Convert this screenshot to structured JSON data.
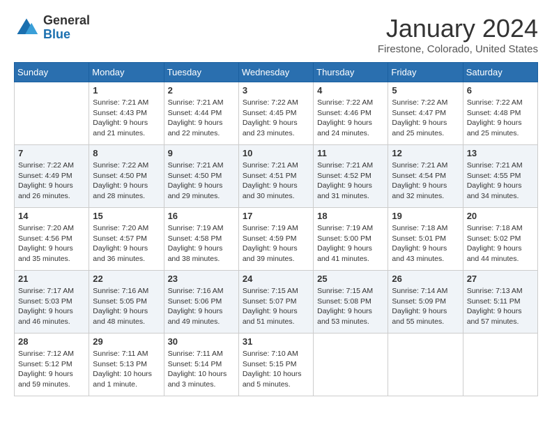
{
  "header": {
    "logo": {
      "general": "General",
      "blue": "Blue"
    },
    "title": "January 2024",
    "location": "Firestone, Colorado, United States"
  },
  "calendar": {
    "days_of_week": [
      "Sunday",
      "Monday",
      "Tuesday",
      "Wednesday",
      "Thursday",
      "Friday",
      "Saturday"
    ],
    "weeks": [
      [
        {
          "day": "",
          "info": ""
        },
        {
          "day": "1",
          "info": "Sunrise: 7:21 AM\nSunset: 4:43 PM\nDaylight: 9 hours\nand 21 minutes."
        },
        {
          "day": "2",
          "info": "Sunrise: 7:21 AM\nSunset: 4:44 PM\nDaylight: 9 hours\nand 22 minutes."
        },
        {
          "day": "3",
          "info": "Sunrise: 7:22 AM\nSunset: 4:45 PM\nDaylight: 9 hours\nand 23 minutes."
        },
        {
          "day": "4",
          "info": "Sunrise: 7:22 AM\nSunset: 4:46 PM\nDaylight: 9 hours\nand 24 minutes."
        },
        {
          "day": "5",
          "info": "Sunrise: 7:22 AM\nSunset: 4:47 PM\nDaylight: 9 hours\nand 25 minutes."
        },
        {
          "day": "6",
          "info": "Sunrise: 7:22 AM\nSunset: 4:48 PM\nDaylight: 9 hours\nand 25 minutes."
        }
      ],
      [
        {
          "day": "7",
          "info": "Sunrise: 7:22 AM\nSunset: 4:49 PM\nDaylight: 9 hours\nand 26 minutes."
        },
        {
          "day": "8",
          "info": "Sunrise: 7:22 AM\nSunset: 4:50 PM\nDaylight: 9 hours\nand 28 minutes."
        },
        {
          "day": "9",
          "info": "Sunrise: 7:21 AM\nSunset: 4:50 PM\nDaylight: 9 hours\nand 29 minutes."
        },
        {
          "day": "10",
          "info": "Sunrise: 7:21 AM\nSunset: 4:51 PM\nDaylight: 9 hours\nand 30 minutes."
        },
        {
          "day": "11",
          "info": "Sunrise: 7:21 AM\nSunset: 4:52 PM\nDaylight: 9 hours\nand 31 minutes."
        },
        {
          "day": "12",
          "info": "Sunrise: 7:21 AM\nSunset: 4:54 PM\nDaylight: 9 hours\nand 32 minutes."
        },
        {
          "day": "13",
          "info": "Sunrise: 7:21 AM\nSunset: 4:55 PM\nDaylight: 9 hours\nand 34 minutes."
        }
      ],
      [
        {
          "day": "14",
          "info": "Sunrise: 7:20 AM\nSunset: 4:56 PM\nDaylight: 9 hours\nand 35 minutes."
        },
        {
          "day": "15",
          "info": "Sunrise: 7:20 AM\nSunset: 4:57 PM\nDaylight: 9 hours\nand 36 minutes."
        },
        {
          "day": "16",
          "info": "Sunrise: 7:19 AM\nSunset: 4:58 PM\nDaylight: 9 hours\nand 38 minutes."
        },
        {
          "day": "17",
          "info": "Sunrise: 7:19 AM\nSunset: 4:59 PM\nDaylight: 9 hours\nand 39 minutes."
        },
        {
          "day": "18",
          "info": "Sunrise: 7:19 AM\nSunset: 5:00 PM\nDaylight: 9 hours\nand 41 minutes."
        },
        {
          "day": "19",
          "info": "Sunrise: 7:18 AM\nSunset: 5:01 PM\nDaylight: 9 hours\nand 43 minutes."
        },
        {
          "day": "20",
          "info": "Sunrise: 7:18 AM\nSunset: 5:02 PM\nDaylight: 9 hours\nand 44 minutes."
        }
      ],
      [
        {
          "day": "21",
          "info": "Sunrise: 7:17 AM\nSunset: 5:03 PM\nDaylight: 9 hours\nand 46 minutes."
        },
        {
          "day": "22",
          "info": "Sunrise: 7:16 AM\nSunset: 5:05 PM\nDaylight: 9 hours\nand 48 minutes."
        },
        {
          "day": "23",
          "info": "Sunrise: 7:16 AM\nSunset: 5:06 PM\nDaylight: 9 hours\nand 49 minutes."
        },
        {
          "day": "24",
          "info": "Sunrise: 7:15 AM\nSunset: 5:07 PM\nDaylight: 9 hours\nand 51 minutes."
        },
        {
          "day": "25",
          "info": "Sunrise: 7:15 AM\nSunset: 5:08 PM\nDaylight: 9 hours\nand 53 minutes."
        },
        {
          "day": "26",
          "info": "Sunrise: 7:14 AM\nSunset: 5:09 PM\nDaylight: 9 hours\nand 55 minutes."
        },
        {
          "day": "27",
          "info": "Sunrise: 7:13 AM\nSunset: 5:11 PM\nDaylight: 9 hours\nand 57 minutes."
        }
      ],
      [
        {
          "day": "28",
          "info": "Sunrise: 7:12 AM\nSunset: 5:12 PM\nDaylight: 9 hours\nand 59 minutes."
        },
        {
          "day": "29",
          "info": "Sunrise: 7:11 AM\nSunset: 5:13 PM\nDaylight: 10 hours\nand 1 minute."
        },
        {
          "day": "30",
          "info": "Sunrise: 7:11 AM\nSunset: 5:14 PM\nDaylight: 10 hours\nand 3 minutes."
        },
        {
          "day": "31",
          "info": "Sunrise: 7:10 AM\nSunset: 5:15 PM\nDaylight: 10 hours\nand 5 minutes."
        },
        {
          "day": "",
          "info": ""
        },
        {
          "day": "",
          "info": ""
        },
        {
          "day": "",
          "info": ""
        }
      ]
    ]
  }
}
